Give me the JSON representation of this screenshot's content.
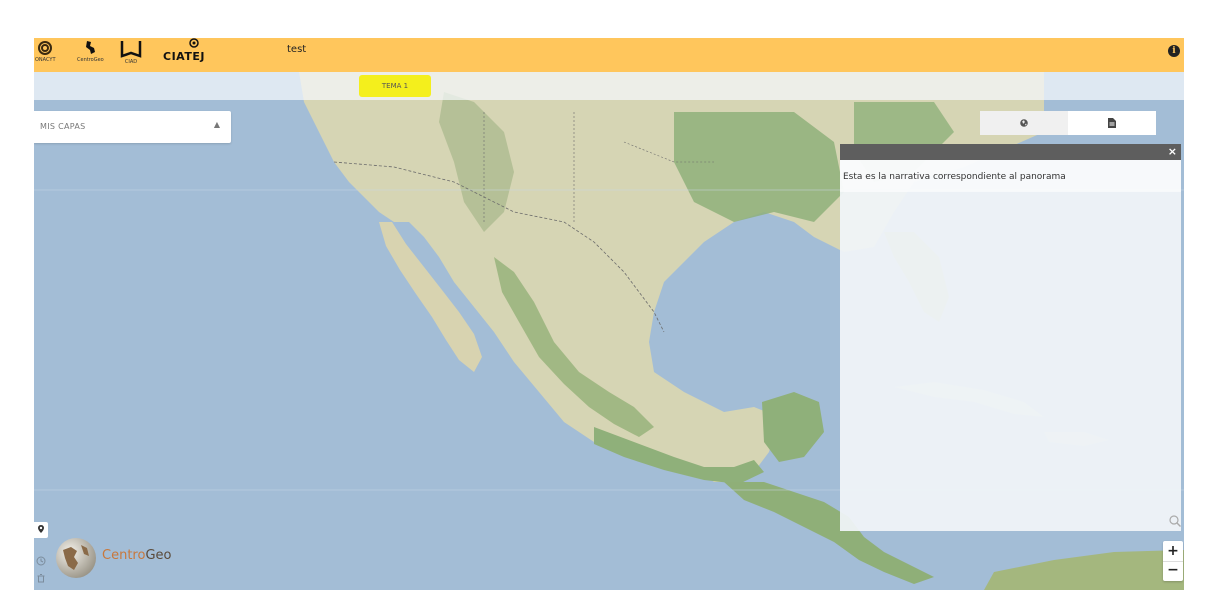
{
  "header": {
    "title": "test",
    "logos": [
      {
        "name": "conacyt",
        "text": "ONACYT"
      },
      {
        "name": "centrogeo-small",
        "text": "CentroGeo"
      },
      {
        "name": "ciad",
        "text": "CIAD"
      },
      {
        "name": "ciatej",
        "text": "CIATEJ"
      }
    ],
    "info_icon": "info-icon"
  },
  "tabs": [
    {
      "label": "TEMA 1",
      "highlight": "#f4ef1c"
    }
  ],
  "layers": {
    "label": "MIS CAPAS",
    "caret": "▲"
  },
  "view_toggle": {
    "map_icon": "globe-icon",
    "doc_icon": "document-icon"
  },
  "panel": {
    "close_label": "×",
    "narrative": "Esta es la narrativa correspondiente al panorama"
  },
  "brand": {
    "part1": "Centro",
    "part2": "Geo"
  },
  "zoom": {
    "in_label": "+",
    "out_label": "−"
  },
  "colors": {
    "header": "#ffc65c",
    "ocean": "#a3bdd6",
    "land": "#d8d6b8",
    "forest": "#8fb07a",
    "tab_highlight": "#f4ef1c",
    "panel_header": "#5e5e5e"
  }
}
